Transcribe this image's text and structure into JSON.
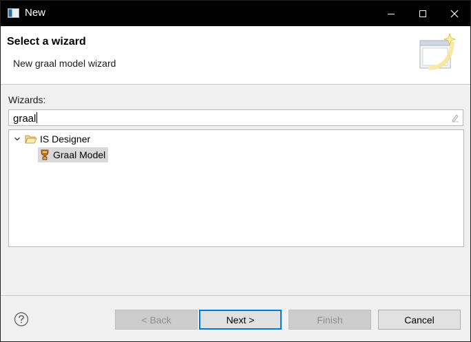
{
  "window": {
    "title": "New"
  },
  "header": {
    "title": "Select a wizard",
    "description": "New graal model wizard"
  },
  "body": {
    "wizards_label": "Wizards:",
    "filter": {
      "value": "graal"
    },
    "tree": {
      "category": {
        "label": "IS Designer",
        "expanded": true
      },
      "items": [
        {
          "label": "Graal Model",
          "selected": true
        }
      ]
    }
  },
  "footer": {
    "back_label": "< Back",
    "next_label": "Next >",
    "finish_label": "Finish",
    "cancel_label": "Cancel"
  },
  "colors": {
    "titlebar": "#000000",
    "selection": "#d9d9d9",
    "default_button_border": "#0078d7"
  }
}
